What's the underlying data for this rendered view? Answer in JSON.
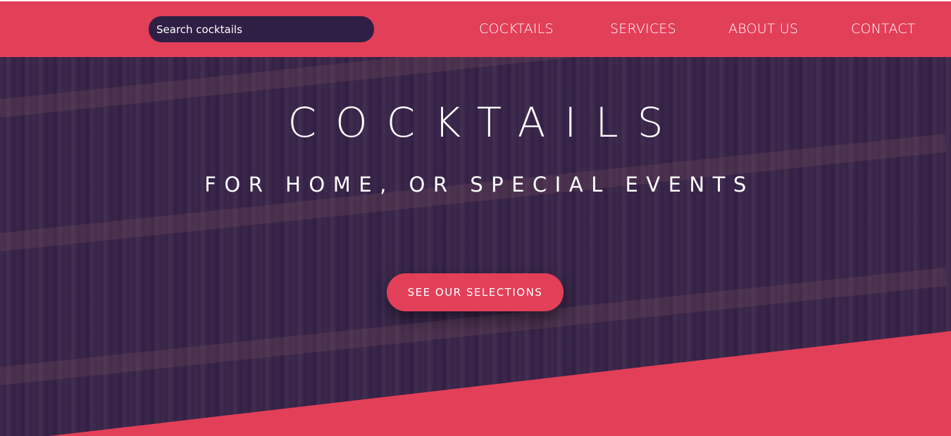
{
  "header": {
    "search": {
      "placeholder": "Search cocktails"
    },
    "nav": [
      {
        "label": "COCKTAILS"
      },
      {
        "label": "SERVICES"
      },
      {
        "label": "ABOUT US"
      },
      {
        "label": "CONTACT"
      }
    ]
  },
  "hero": {
    "title": "COCKTAILS",
    "subtitle": "FOR HOME, OR SPECIAL EVENTS",
    "cta_label": "SEE OUR SELECTIONS"
  },
  "colors": {
    "accent": "#e23f59",
    "dark_purple": "#2f1f45",
    "overlay": "#321e44",
    "text": "#ffffff"
  }
}
